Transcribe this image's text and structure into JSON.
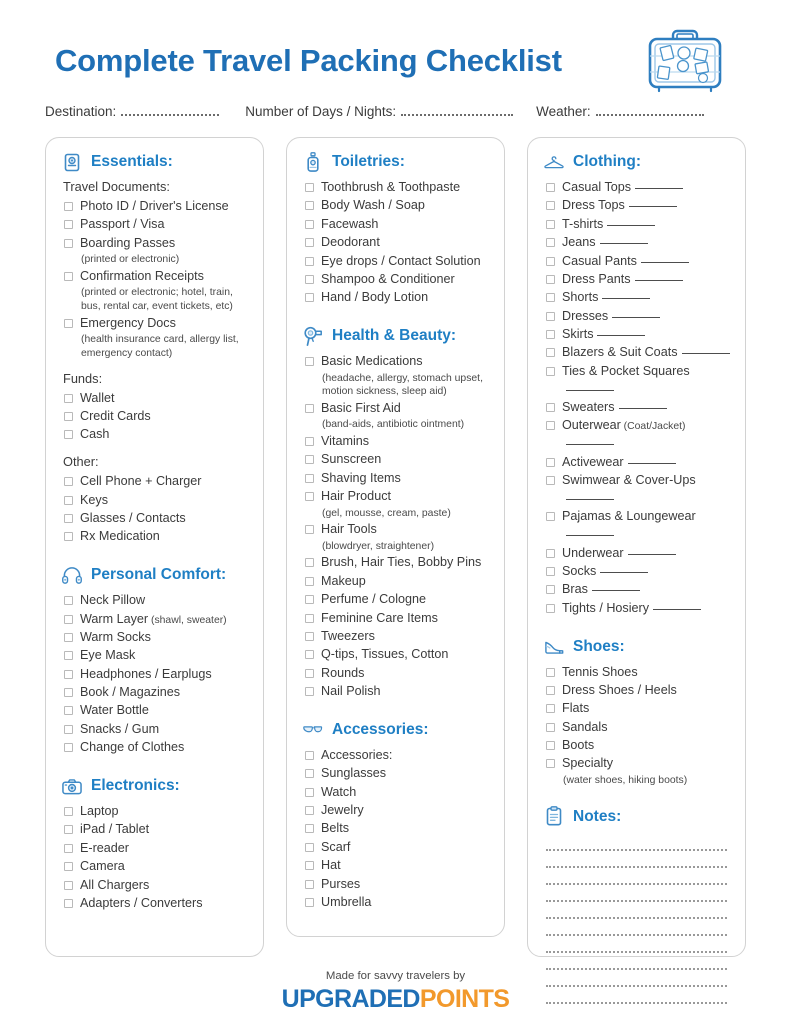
{
  "header": {
    "title": "Complete Travel Packing Checklist",
    "suitcase_icon": "suitcase-icon"
  },
  "fields": [
    {
      "label": "Destination:",
      "value": ""
    },
    {
      "label": "Number of Days / Nights:",
      "value": ""
    },
    {
      "label": "Weather:",
      "value": ""
    }
  ],
  "colors": {
    "heading_blue": "#1f7fc4",
    "title_blue": "#1f6fb5",
    "logo_orange": "#f2992c",
    "text": "#3b3b3b",
    "card_border": "#d2d2d2",
    "checkbox_border": "#b9b9b9"
  },
  "columns": [
    {
      "id": "column-left",
      "sections": [
        {
          "title": "Essentials:",
          "icon": "passport-icon",
          "groups": [
            {
              "label": "Travel Documents:",
              "items": [
                {
                  "text": "Photo ID / Driver's License"
                },
                {
                  "text": "Passport / Visa"
                },
                {
                  "text": "Boarding Passes",
                  "note": "(printed or electronic)"
                },
                {
                  "text": "Confirmation Receipts",
                  "note": "(printed or electronic; hotel, train, bus, rental car, event tickets, etc)"
                },
                {
                  "text": "Emergency Docs",
                  "note": "(health insurance card, allergy list, emergency contact)"
                }
              ]
            },
            {
              "label": "Funds:",
              "items": [
                {
                  "text": "Wallet"
                },
                {
                  "text": "Credit Cards"
                },
                {
                  "text": "Cash"
                }
              ]
            },
            {
              "label": "Other:",
              "items": [
                {
                  "text": "Cell Phone + Charger"
                },
                {
                  "text": "Keys"
                },
                {
                  "text": "Glasses / Contacts"
                },
                {
                  "text": "Rx Medication"
                }
              ]
            }
          ]
        },
        {
          "title": "Personal Comfort:",
          "icon": "headphones-icon",
          "groups": [
            {
              "label": "",
              "items": [
                {
                  "text": "Neck Pillow"
                },
                {
                  "text": "Warm Layer",
                  "inline_note": "(shawl, sweater)"
                },
                {
                  "text": "Warm Socks"
                },
                {
                  "text": "Eye Mask"
                },
                {
                  "text": "Headphones / Earplugs"
                },
                {
                  "text": "Book / Magazines"
                },
                {
                  "text": "Water Bottle"
                },
                {
                  "text": "Snacks / Gum"
                },
                {
                  "text": "Change of Clothes"
                }
              ]
            }
          ]
        },
        {
          "title": "Electronics:",
          "icon": "camera-icon",
          "groups": [
            {
              "label": "",
              "items": [
                {
                  "text": "Laptop"
                },
                {
                  "text": "iPad / Tablet"
                },
                {
                  "text": "E-reader"
                },
                {
                  "text": "Camera"
                },
                {
                  "text": "All Chargers"
                },
                {
                  "text": "Adapters / Converters"
                }
              ]
            }
          ]
        }
      ]
    },
    {
      "id": "column-middle",
      "sections": [
        {
          "title": "Toiletries:",
          "icon": "soap-bottle-icon",
          "groups": [
            {
              "label": "",
              "items": [
                {
                  "text": "Toothbrush & Toothpaste"
                },
                {
                  "text": "Body Wash / Soap"
                },
                {
                  "text": "Facewash"
                },
                {
                  "text": "Deodorant"
                },
                {
                  "text": "Eye drops / Contact Solution"
                },
                {
                  "text": "Shampoo & Conditioner"
                },
                {
                  "text": "Hand / Body Lotion"
                }
              ]
            }
          ]
        },
        {
          "title": "Health & Beauty:",
          "icon": "hairdryer-icon",
          "groups": [
            {
              "label": "",
              "items": [
                {
                  "text": "Basic Medications",
                  "note": "(headache, allergy, stomach upset, motion sickness, sleep aid)"
                },
                {
                  "text": "Basic First Aid",
                  "note": "(band-aids, antibiotic ointment)"
                },
                {
                  "text": "Vitamins"
                },
                {
                  "text": "Sunscreen"
                },
                {
                  "text": "Shaving Items"
                },
                {
                  "text": "Hair Product",
                  "note": "(gel, mousse, cream, paste)"
                },
                {
                  "text": "Hair Tools",
                  "note": "(blowdryer, straightener)"
                },
                {
                  "text": "Brush, Hair Ties, Bobby Pins"
                },
                {
                  "text": "Makeup"
                },
                {
                  "text": "Perfume / Cologne"
                },
                {
                  "text": "Feminine Care Items"
                },
                {
                  "text": "Tweezers"
                },
                {
                  "text": "Q-tips, Tissues, Cotton"
                },
                {
                  "text": "Rounds"
                },
                {
                  "text": "Nail Polish"
                }
              ]
            }
          ]
        },
        {
          "title": "Accessories:",
          "icon": "sunglasses-icon",
          "groups": [
            {
              "label": "",
              "items": [
                {
                  "text": "Accessories:"
                },
                {
                  "text": "Sunglasses"
                },
                {
                  "text": "Watch"
                },
                {
                  "text": "Jewelry"
                },
                {
                  "text": "Belts"
                },
                {
                  "text": "Scarf"
                },
                {
                  "text": "Hat"
                },
                {
                  "text": "Purses"
                },
                {
                  "text": "Umbrella"
                }
              ]
            }
          ]
        }
      ]
    },
    {
      "id": "column-right",
      "sections": [
        {
          "title": "Clothing:",
          "icon": "hanger-icon",
          "groups": [
            {
              "label": "",
              "items": [
                {
                  "text": "Casual Tops",
                  "blank": true
                },
                {
                  "text": "Dress Tops",
                  "blank": true
                },
                {
                  "text": "T-shirts",
                  "blank": true
                },
                {
                  "text": "Jeans",
                  "blank": true
                },
                {
                  "text": "Casual Pants",
                  "blank": true
                },
                {
                  "text": "Dress Pants",
                  "blank": true
                },
                {
                  "text": "Shorts",
                  "blank": true
                },
                {
                  "text": "Dresses",
                  "blank": true
                },
                {
                  "text": "Skirts",
                  "blank": true
                },
                {
                  "text": "Blazers & Suit Coats",
                  "blank": true
                },
                {
                  "text": "Ties & Pocket Squares",
                  "blank": true
                },
                {
                  "text": "Sweaters",
                  "blank": true
                },
                {
                  "text": "Outerwear",
                  "inline_note": "(Coat/Jacket)",
                  "blank": true
                },
                {
                  "text": "Activewear",
                  "blank": true
                },
                {
                  "text": "Swimwear & Cover-Ups",
                  "blank": true
                },
                {
                  "text": "Pajamas & Loungewear",
                  "blank": true
                },
                {
                  "text": "Underwear",
                  "blank": true
                },
                {
                  "text": "Socks",
                  "blank": true
                },
                {
                  "text": "Bras",
                  "blank": true
                },
                {
                  "text": "Tights / Hosiery",
                  "blank": true
                }
              ]
            }
          ]
        },
        {
          "title": "Shoes:",
          "icon": "high-heel-icon",
          "groups": [
            {
              "label": "",
              "items": [
                {
                  "text": "Tennis Shoes"
                },
                {
                  "text": "Dress Shoes / Heels"
                },
                {
                  "text": "Flats"
                },
                {
                  "text": "Sandals"
                },
                {
                  "text": "Boots"
                },
                {
                  "text": "Specialty",
                  "note": "(water shoes, hiking boots)"
                }
              ]
            }
          ]
        },
        {
          "title": "Notes:",
          "icon": "clipboard-icon",
          "notes_line_count": 10,
          "groups": []
        }
      ]
    }
  ],
  "footer": {
    "made_by": "Made for savvy travelers by",
    "logo_first": "UPGRADED",
    "logo_second": "POINTS"
  }
}
